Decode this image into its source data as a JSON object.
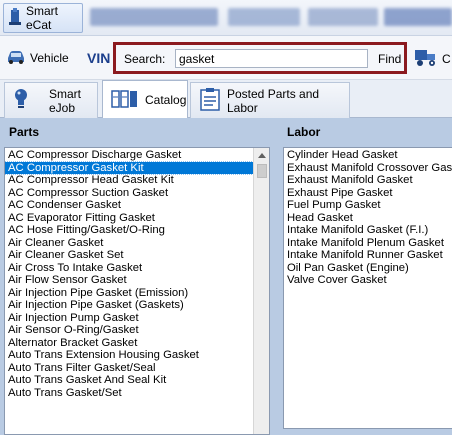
{
  "toolbar": {
    "smart_ecat_label": "Smart eCat"
  },
  "search_bar": {
    "vehicle_label": "Vehicle",
    "vin_label": "VIN",
    "search_label": "Search:",
    "search_value": "gasket",
    "find_label": "Find",
    "right_partial_label": "C"
  },
  "tabs": [
    {
      "label": "Smart eJob",
      "icon": "bulb-icon"
    },
    {
      "label": "Catalog",
      "icon": "catalog-icon",
      "active": true
    },
    {
      "label": "Posted Parts and Labor",
      "icon": "posted-parts-icon"
    }
  ],
  "parts": {
    "title": "Parts",
    "items": [
      "AC Compressor Discharge Gasket",
      "AC Compressor Gasket Kit",
      "AC Compressor Head Gasket Kit",
      "AC Compressor Suction Gasket",
      "AC Condenser Gasket",
      "AC Evaporator Fitting Gasket",
      "AC Hose Fitting/Gasket/O-Ring",
      "Air Cleaner Gasket",
      "Air Cleaner Gasket Set",
      "Air Cross To Intake Gasket",
      "Air Flow Sensor Gasket",
      "Air Injection Pipe Gasket (Emission)",
      "Air Injection Pipe Gasket (Gaskets)",
      "Air Injection Pump Gasket",
      "Air Sensor O-Ring/Gasket",
      "Alternator Bracket Gasket",
      "Auto Trans Extension Housing Gasket",
      "Auto Trans Filter Gasket/Seal",
      "Auto Trans Gasket And Seal Kit",
      "Auto Trans Gasket/Set"
    ],
    "selected": "AC Compressor Gasket Kit"
  },
  "labor": {
    "title": "Labor",
    "items": [
      "Cylinder Head Gasket",
      "Exhaust Manifold Crossover Gasket",
      "Exhaust Manifold Gasket",
      "Exhaust Pipe Gasket",
      "Fuel Pump Gasket",
      "Head Gasket",
      "Intake Manifold Gasket (F.I.)",
      "Intake Manifold Plenum Gasket",
      "Intake Manifold Runner Gasket",
      "Oil Pan Gasket (Engine)",
      "Valve Cover Gasket"
    ]
  },
  "colors": {
    "accent_frame": "#8b1a1f",
    "selection": "#0078d7",
    "panel_bg": "#b9cbe3",
    "vin": "#1c3f8c"
  }
}
